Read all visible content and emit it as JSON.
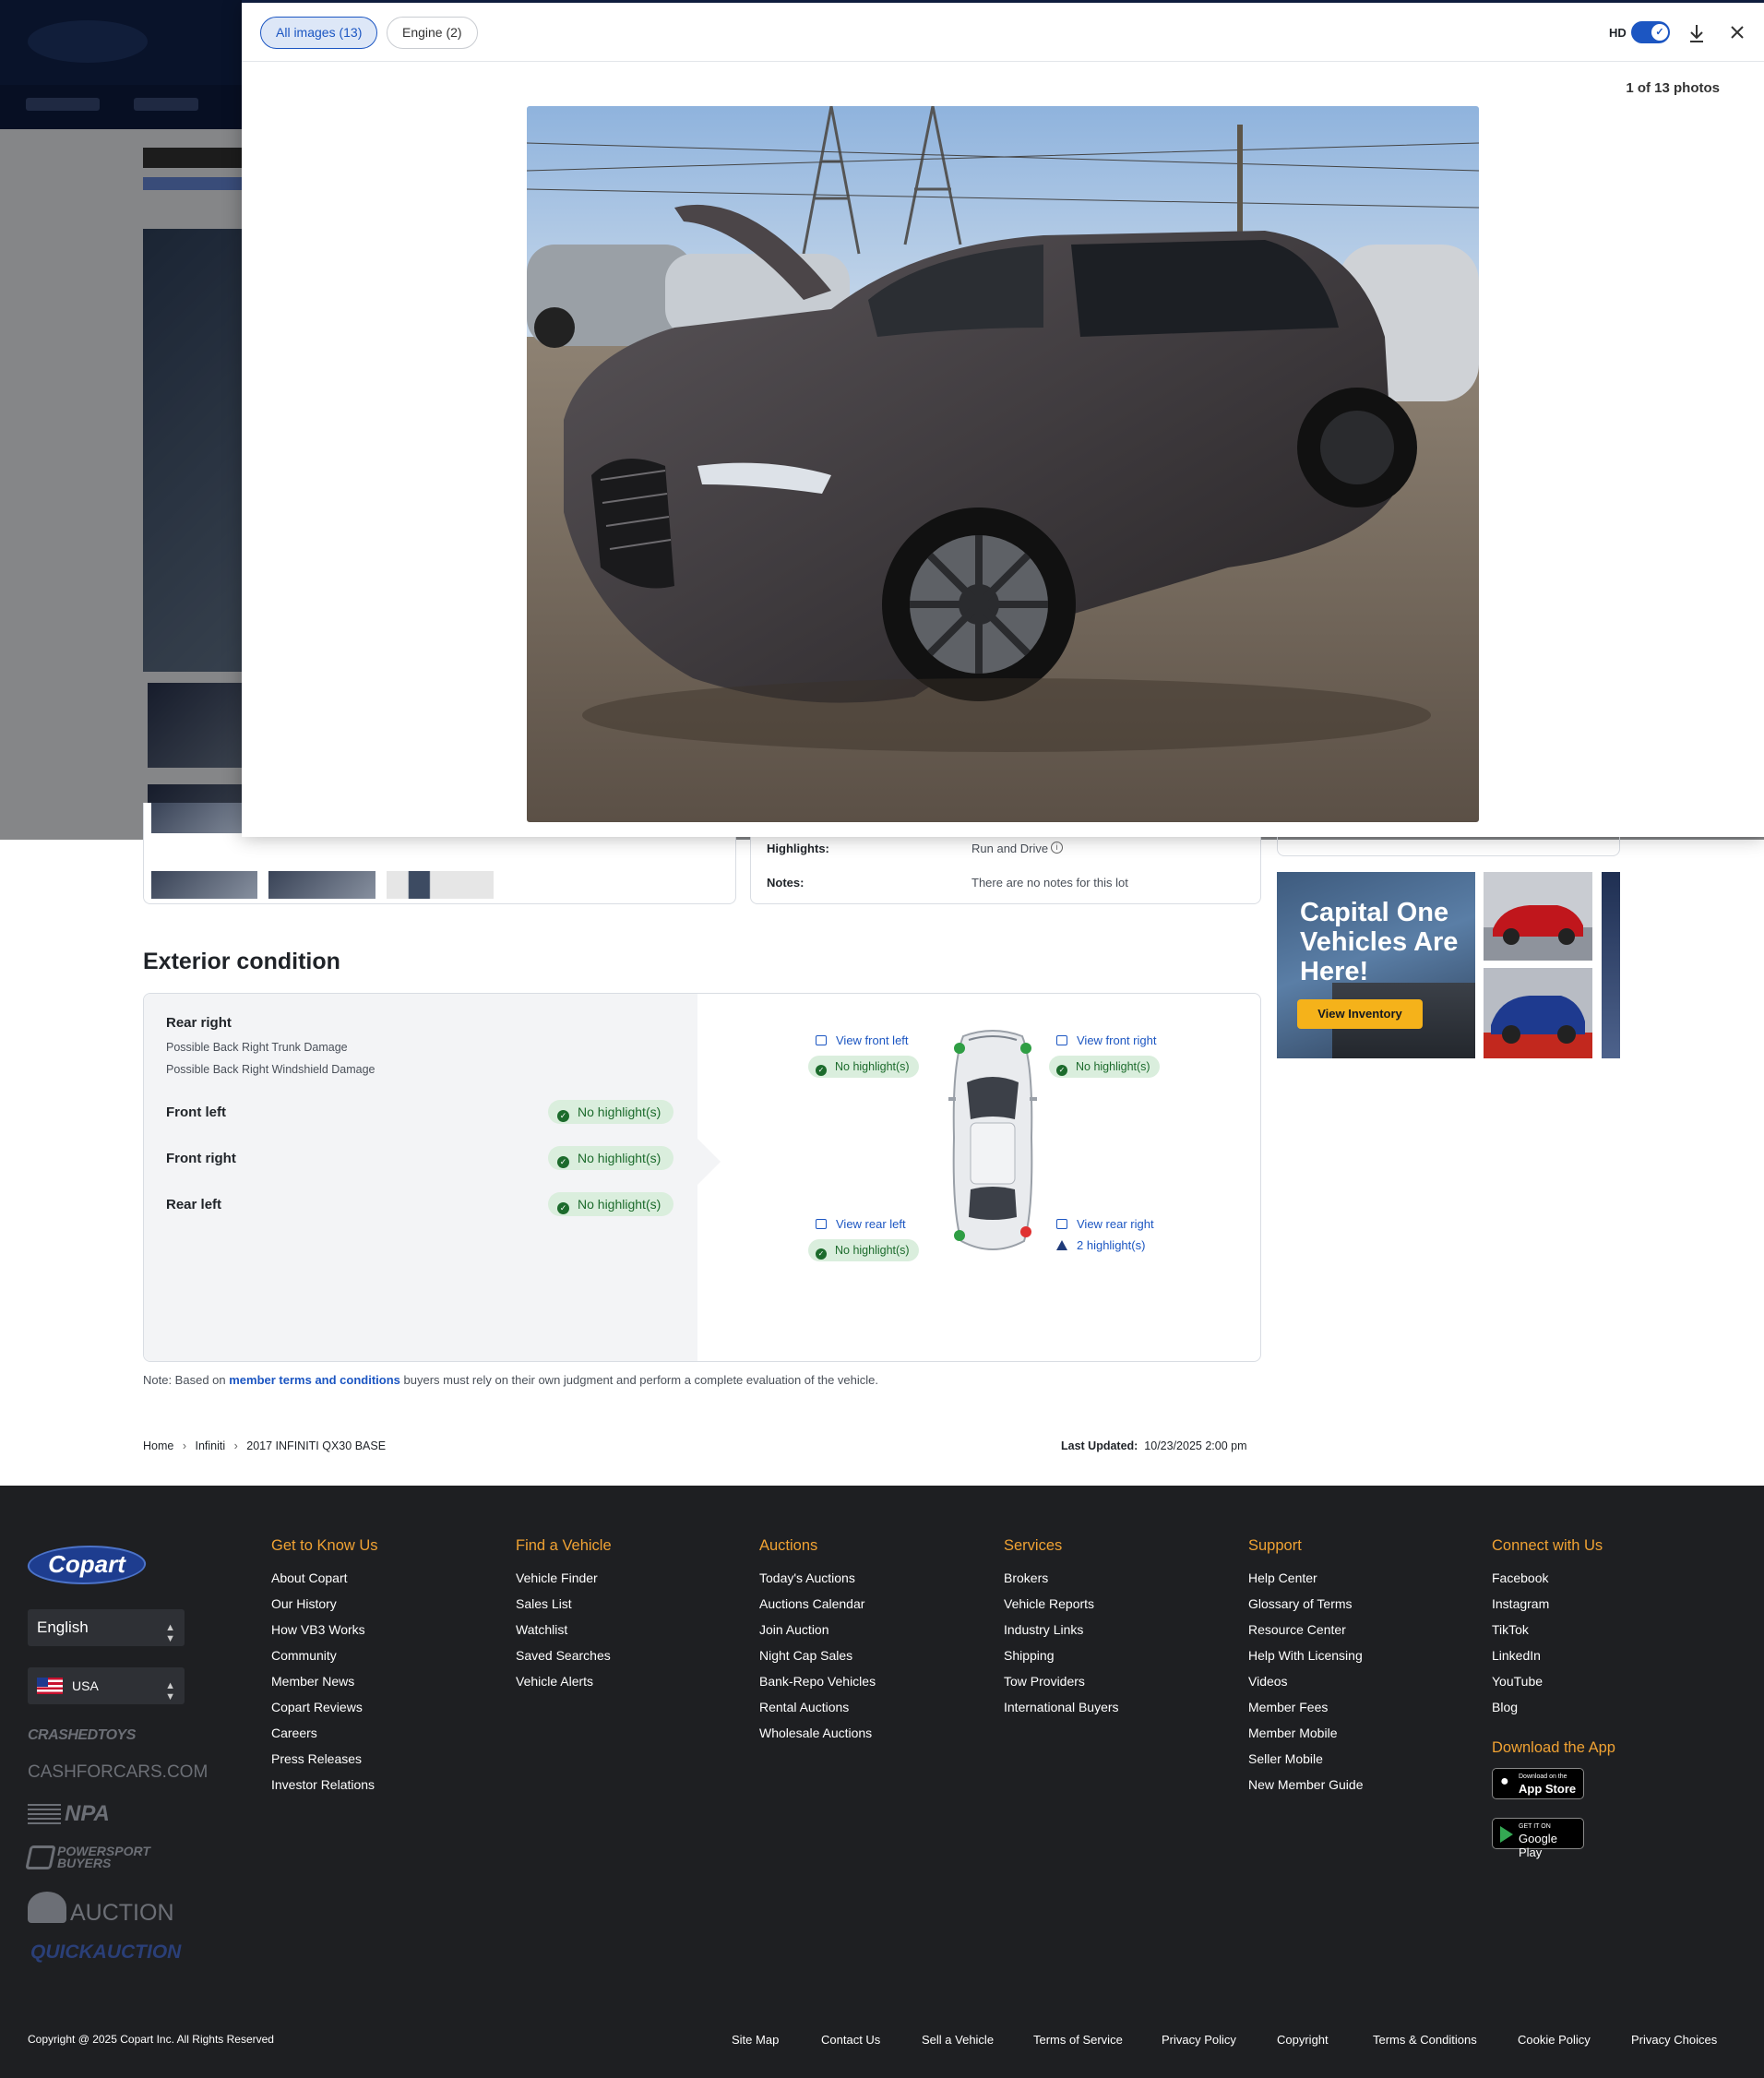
{
  "modal": {
    "tabs": [
      {
        "label": "All images (13)"
      },
      {
        "label": "Engine (2)"
      }
    ],
    "hd_label": "HD",
    "photo_count": "1 of 13 photos"
  },
  "lot_info": {
    "highlights_label": "Highlights:",
    "highlights_value": "Run and Drive",
    "notes_label": "Notes:",
    "notes_value": "There are no notes for this lot"
  },
  "ad": {
    "headline": "Capital One Vehicles Are Here!",
    "button": "View Inventory"
  },
  "exterior": {
    "title": "Exterior condition",
    "zones": [
      {
        "name": "Rear right",
        "details": [
          "Possible Back Right Trunk Damage",
          "Possible Back Right Windshield Damage"
        ]
      },
      {
        "name": "Front left",
        "status": "No highlight(s)"
      },
      {
        "name": "Front right",
        "status": "No highlight(s)"
      },
      {
        "name": "Rear left",
        "status": "No highlight(s)"
      }
    ],
    "diagram": {
      "front_left": {
        "link": "View front left",
        "status": "No highlight(s)"
      },
      "front_right": {
        "link": "View front right",
        "status": "No highlight(s)"
      },
      "rear_left": {
        "link": "View rear left",
        "status": "No highlight(s)"
      },
      "rear_right": {
        "link": "View rear right",
        "status": "2 highlight(s)"
      }
    },
    "colors": {
      "ok": "#2f9e44",
      "damage": "#e03131"
    }
  },
  "note": {
    "prefix": "Note: Based on ",
    "link": "member terms and conditions",
    "suffix": " buyers must rely on their own judgment and perform a complete evaluation of the vehicle."
  },
  "breadcrumb": [
    "Home",
    "Infiniti",
    "2017 INFINITI QX30 BASE"
  ],
  "last_updated": {
    "label": "Last Updated:",
    "value": "10/23/2025 2:00 pm"
  },
  "footer": {
    "logo": "Copart",
    "language": "English",
    "country": "USA",
    "brands": [
      "CRASHEDTOYS",
      "CASHFORCARS.COM",
      "NPA",
      "POWERSPORT BUYERS",
      "AUCTION",
      "QUICKAUCTION"
    ],
    "columns": [
      {
        "title": "Get to Know Us",
        "links": [
          "About Copart",
          "Our History",
          "How VB3 Works",
          "Community",
          "Member News",
          "Copart Reviews",
          "Careers",
          "Press Releases",
          "Investor Relations"
        ]
      },
      {
        "title": "Find a Vehicle",
        "links": [
          "Vehicle Finder",
          "Sales List",
          "Watchlist",
          "Saved Searches",
          "Vehicle Alerts"
        ]
      },
      {
        "title": "Auctions",
        "links": [
          "Today's Auctions",
          "Auctions Calendar",
          "Join Auction",
          "Night Cap Sales",
          "Bank-Repo Vehicles",
          "Rental Auctions",
          "Wholesale Auctions"
        ]
      },
      {
        "title": "Services",
        "links": [
          "Brokers",
          "Vehicle Reports",
          "Industry Links",
          "Shipping",
          "Tow Providers",
          "International Buyers"
        ]
      },
      {
        "title": "Support",
        "links": [
          "Help Center",
          "Glossary of Terms",
          "Resource Center",
          "Help With Licensing",
          "Videos",
          "Member Fees",
          "Member Mobile",
          "Seller Mobile",
          "New Member Guide"
        ]
      },
      {
        "title": "Connect with Us",
        "links": [
          "Facebook",
          "Instagram",
          "TikTok",
          "LinkedIn",
          "YouTube",
          "Blog"
        ]
      }
    ],
    "app_title": "Download the App",
    "app_store": {
      "small": "Download on the",
      "big": "App Store"
    },
    "google_play": {
      "small": "GET IT ON",
      "big": "Google Play"
    },
    "copyright": "Copyright @ 2025 Copart Inc. All Rights Reserved",
    "bottom_links": [
      "Site Map",
      "Contact Us",
      "Sell a Vehicle",
      "Terms of Service",
      "Privacy Policy",
      "Copyright",
      "Terms & Conditions",
      "Cookie Policy",
      "Privacy Choices"
    ]
  }
}
